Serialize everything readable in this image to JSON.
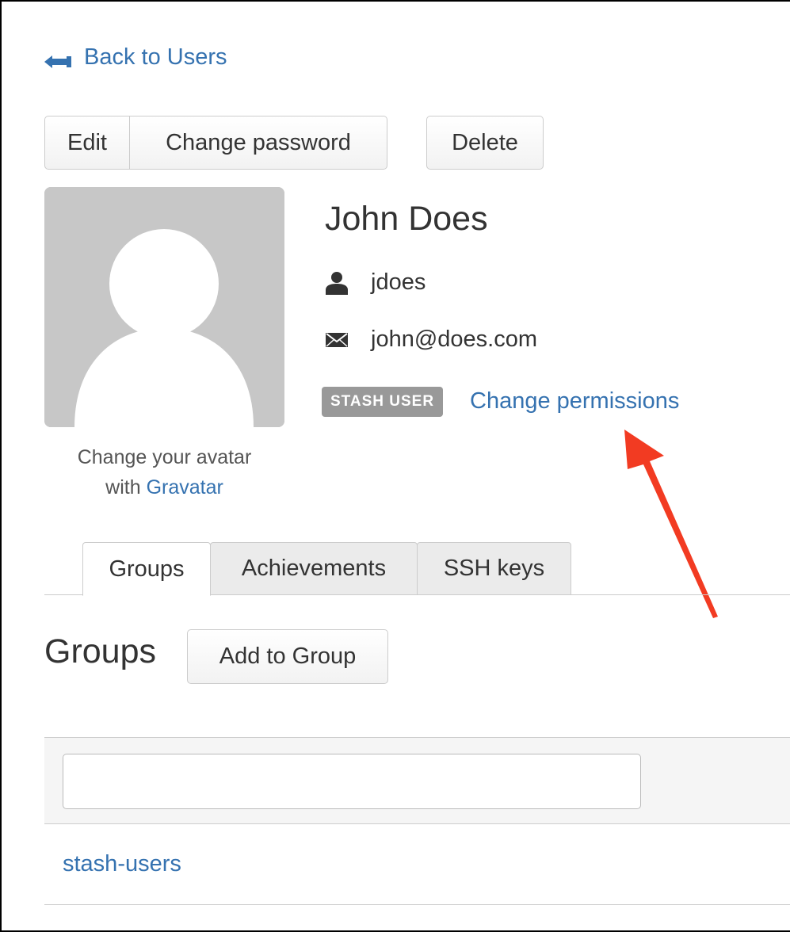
{
  "nav": {
    "back_label": "Back to Users"
  },
  "actions": {
    "edit_label": "Edit",
    "change_password_label": "Change password",
    "delete_label": "Delete"
  },
  "avatar": {
    "caption_prefix": "Change your avatar",
    "caption_with": "with",
    "caption_link": "Gravatar"
  },
  "user": {
    "display_name": "John Does",
    "username": "jdoes",
    "email": "john@does.com",
    "role_badge": "STASH USER",
    "change_permissions_label": "Change permissions"
  },
  "tabs": [
    {
      "label": "Groups",
      "active": true
    },
    {
      "label": "Achievements",
      "active": false
    },
    {
      "label": "SSH keys",
      "active": false
    }
  ],
  "groups_section": {
    "title": "Groups",
    "add_button_label": "Add to Group",
    "filter_value": "",
    "items": [
      "stash-users"
    ]
  },
  "icons": {
    "back": "back-arrow-icon",
    "username": "user-icon",
    "email": "envelope-icon"
  },
  "colors": {
    "link": "#3572b0",
    "badge_bg": "#999999",
    "annotation_arrow": "#f23b22"
  }
}
